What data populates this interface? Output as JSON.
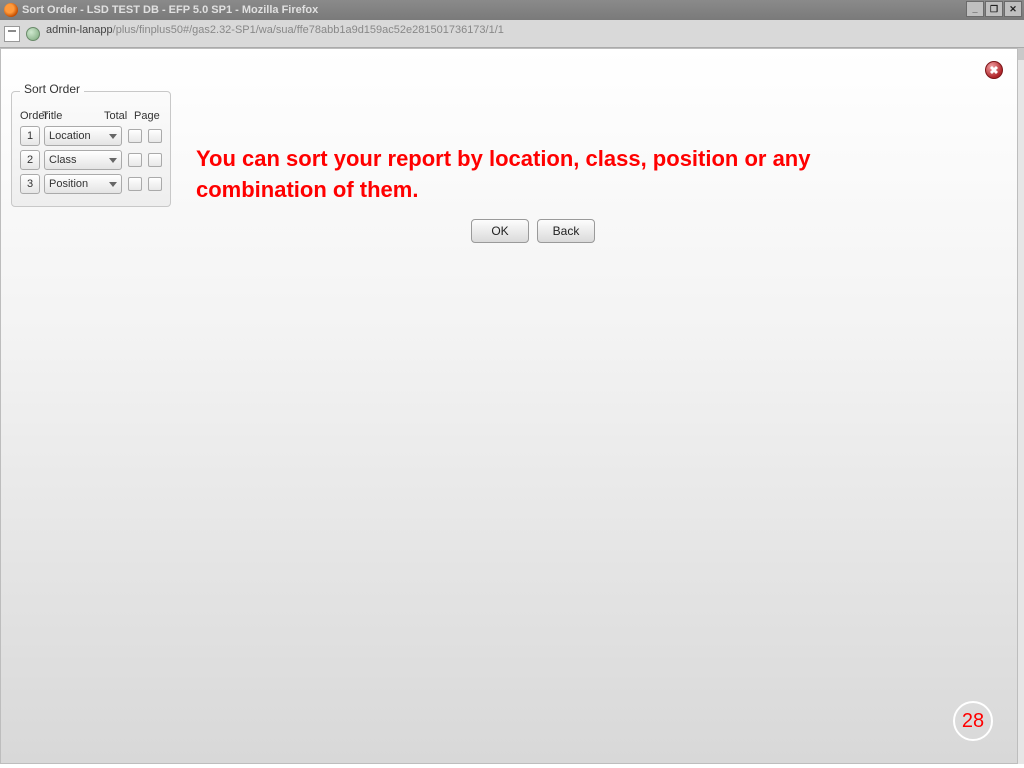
{
  "window": {
    "title": "Sort Order - LSD TEST DB - EFP 5.0 SP1 - Mozilla Firefox",
    "min_label": "_",
    "max_label": "❐",
    "close_label": "✕"
  },
  "addressbar": {
    "host": "admin-lanapp",
    "path": "/plus/finplus50#/gas2.32-SP1/wa/sua/ffe78abb1a9d159ac52e281501736173/1/1"
  },
  "close_badge": {
    "glyph": "✖"
  },
  "sort": {
    "legend": "Sort Order",
    "headers": {
      "order": "Order",
      "title": "Title",
      "total": "Total",
      "page": "Page"
    },
    "rows": [
      {
        "order": "1",
        "title": "Location"
      },
      {
        "order": "2",
        "title": "Class"
      },
      {
        "order": "3",
        "title": "Position"
      }
    ]
  },
  "annotation": "You can sort your report by location, class, position or any combination of them.",
  "buttons": {
    "ok": "OK",
    "back": "Back"
  },
  "page_number": "28"
}
